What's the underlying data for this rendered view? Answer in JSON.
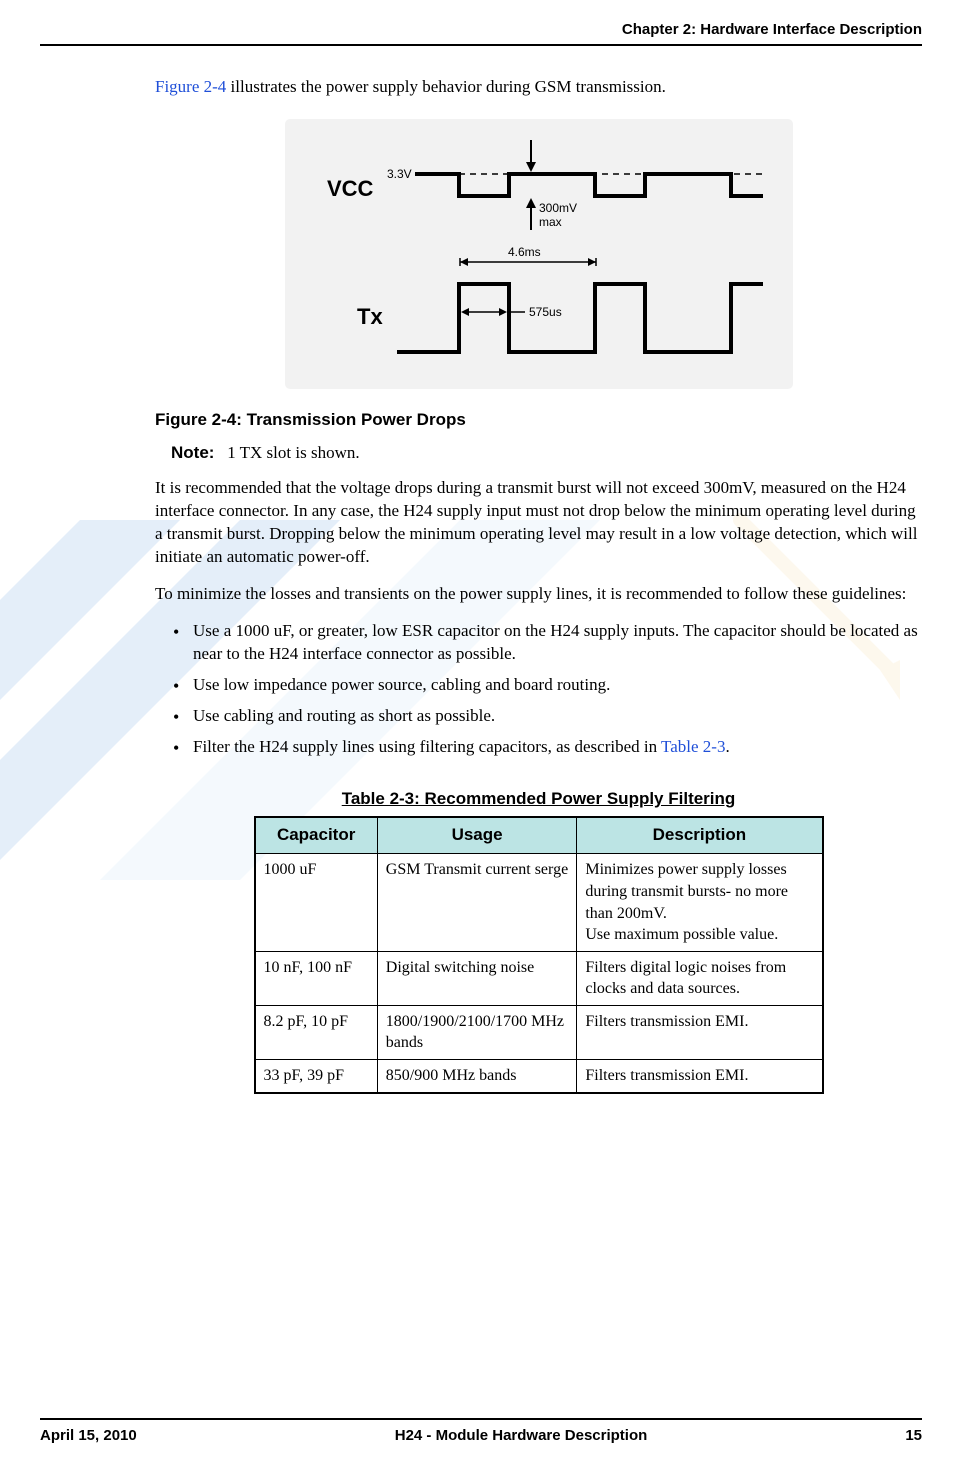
{
  "header": {
    "chapter_title": "Chapter 2:  Hardware Interface Description"
  },
  "intro": {
    "figure_ref": "Figure 2-4",
    "rest": " illustrates the power supply behavior during GSM transmission."
  },
  "figure": {
    "labels": {
      "vcc": "VCC",
      "tx": "Tx",
      "voltage": "3.3V",
      "drop": "300mV",
      "drop2": "max",
      "period": "4.6ms",
      "pulse": "575us"
    },
    "caption": "Figure 2-4: Transmission Power Drops"
  },
  "note": {
    "label": "Note:",
    "text": "1 TX slot is shown."
  },
  "para1": "It is recommended that the voltage drops during a transmit burst will not exceed 300mV, measured on the H24 interface connector. In any case, the H24 supply input must not drop below the minimum operating level during a transmit burst. Dropping below the minimum operating level may result in a low voltage detection, which will initiate an automatic power-off.",
  "para2": "To minimize the losses and transients on the power supply lines, it is recommended to follow these guidelines:",
  "bullets": [
    "Use a 1000 uF, or greater, low ESR capacitor on the H24 supply inputs. The capacitor should be located as near to the H24 interface connector as possible.",
    "Use low impedance power source, cabling and board routing.",
    "Use cabling and routing as short as possible."
  ],
  "bullet4": {
    "pre": "Filter the H24 supply lines using filtering capacitors, as described in ",
    "link": "Table 2-3",
    "post": "."
  },
  "table": {
    "caption": "Table 2-3: Recommended Power Supply Filtering",
    "headers": {
      "c1": "Capacitor",
      "c2": "Usage",
      "c3": "Description"
    },
    "rows": [
      {
        "cap": "1000 uF",
        "usage": "GSM Transmit current serge",
        "desc": "Minimizes power supply losses during transmit bursts- no more than 200mV.\nUse maximum possible value."
      },
      {
        "cap": "10 nF, 100 nF",
        "usage": "Digital switching noise",
        "desc": "Filters digital logic noises from clocks and data sources."
      },
      {
        "cap": "8.2 pF, 10 pF",
        "usage": "1800/1900/2100/1700 MHz bands",
        "desc": "Filters transmission EMI."
      },
      {
        "cap": "33 pF, 39 pF",
        "usage": "850/900 MHz bands",
        "desc": "Filters transmission EMI."
      }
    ]
  },
  "footer": {
    "date": "April 15, 2010",
    "title": "H24 - Module Hardware Description",
    "page": "15"
  }
}
